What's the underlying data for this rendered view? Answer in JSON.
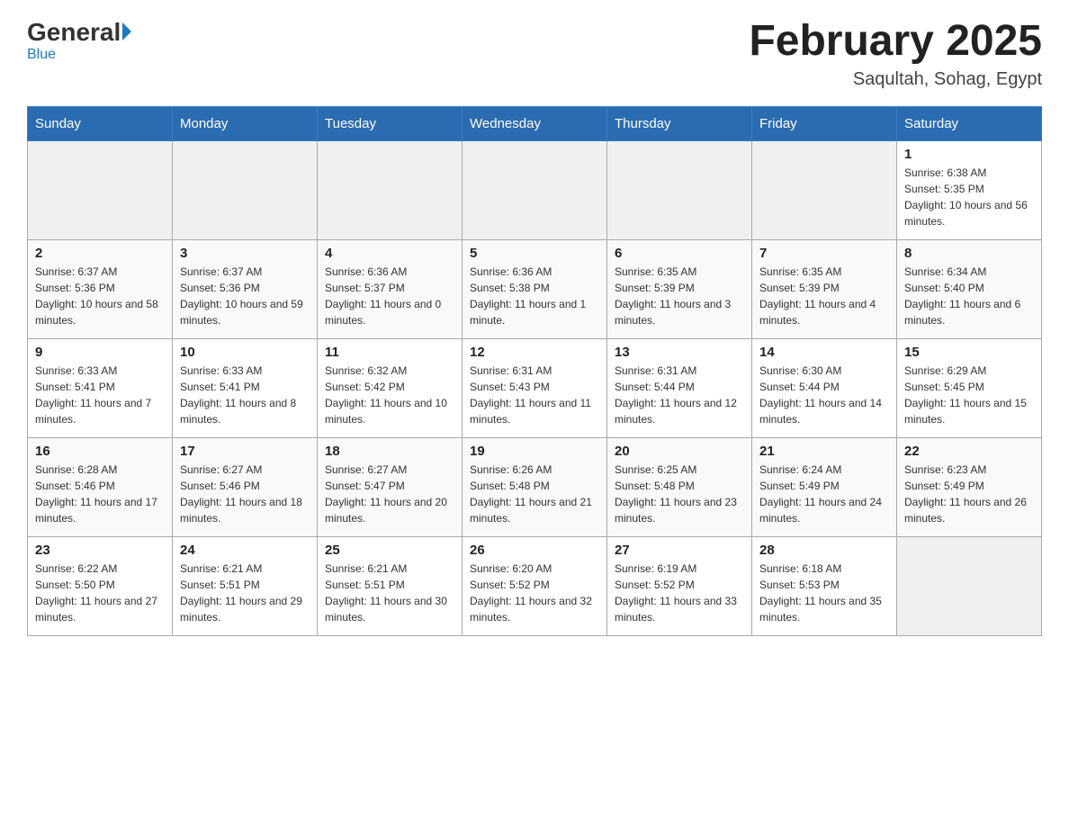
{
  "header": {
    "logo_general": "General",
    "logo_blue": "Blue",
    "month_title": "February 2025",
    "location": "Saqultah, Sohag, Egypt"
  },
  "days_of_week": [
    "Sunday",
    "Monday",
    "Tuesday",
    "Wednesday",
    "Thursday",
    "Friday",
    "Saturday"
  ],
  "weeks": [
    [
      {
        "day": "",
        "info": ""
      },
      {
        "day": "",
        "info": ""
      },
      {
        "day": "",
        "info": ""
      },
      {
        "day": "",
        "info": ""
      },
      {
        "day": "",
        "info": ""
      },
      {
        "day": "",
        "info": ""
      },
      {
        "day": "1",
        "info": "Sunrise: 6:38 AM\nSunset: 5:35 PM\nDaylight: 10 hours and 56 minutes."
      }
    ],
    [
      {
        "day": "2",
        "info": "Sunrise: 6:37 AM\nSunset: 5:36 PM\nDaylight: 10 hours and 58 minutes."
      },
      {
        "day": "3",
        "info": "Sunrise: 6:37 AM\nSunset: 5:36 PM\nDaylight: 10 hours and 59 minutes."
      },
      {
        "day": "4",
        "info": "Sunrise: 6:36 AM\nSunset: 5:37 PM\nDaylight: 11 hours and 0 minutes."
      },
      {
        "day": "5",
        "info": "Sunrise: 6:36 AM\nSunset: 5:38 PM\nDaylight: 11 hours and 1 minute."
      },
      {
        "day": "6",
        "info": "Sunrise: 6:35 AM\nSunset: 5:39 PM\nDaylight: 11 hours and 3 minutes."
      },
      {
        "day": "7",
        "info": "Sunrise: 6:35 AM\nSunset: 5:39 PM\nDaylight: 11 hours and 4 minutes."
      },
      {
        "day": "8",
        "info": "Sunrise: 6:34 AM\nSunset: 5:40 PM\nDaylight: 11 hours and 6 minutes."
      }
    ],
    [
      {
        "day": "9",
        "info": "Sunrise: 6:33 AM\nSunset: 5:41 PM\nDaylight: 11 hours and 7 minutes."
      },
      {
        "day": "10",
        "info": "Sunrise: 6:33 AM\nSunset: 5:41 PM\nDaylight: 11 hours and 8 minutes."
      },
      {
        "day": "11",
        "info": "Sunrise: 6:32 AM\nSunset: 5:42 PM\nDaylight: 11 hours and 10 minutes."
      },
      {
        "day": "12",
        "info": "Sunrise: 6:31 AM\nSunset: 5:43 PM\nDaylight: 11 hours and 11 minutes."
      },
      {
        "day": "13",
        "info": "Sunrise: 6:31 AM\nSunset: 5:44 PM\nDaylight: 11 hours and 12 minutes."
      },
      {
        "day": "14",
        "info": "Sunrise: 6:30 AM\nSunset: 5:44 PM\nDaylight: 11 hours and 14 minutes."
      },
      {
        "day": "15",
        "info": "Sunrise: 6:29 AM\nSunset: 5:45 PM\nDaylight: 11 hours and 15 minutes."
      }
    ],
    [
      {
        "day": "16",
        "info": "Sunrise: 6:28 AM\nSunset: 5:46 PM\nDaylight: 11 hours and 17 minutes."
      },
      {
        "day": "17",
        "info": "Sunrise: 6:27 AM\nSunset: 5:46 PM\nDaylight: 11 hours and 18 minutes."
      },
      {
        "day": "18",
        "info": "Sunrise: 6:27 AM\nSunset: 5:47 PM\nDaylight: 11 hours and 20 minutes."
      },
      {
        "day": "19",
        "info": "Sunrise: 6:26 AM\nSunset: 5:48 PM\nDaylight: 11 hours and 21 minutes."
      },
      {
        "day": "20",
        "info": "Sunrise: 6:25 AM\nSunset: 5:48 PM\nDaylight: 11 hours and 23 minutes."
      },
      {
        "day": "21",
        "info": "Sunrise: 6:24 AM\nSunset: 5:49 PM\nDaylight: 11 hours and 24 minutes."
      },
      {
        "day": "22",
        "info": "Sunrise: 6:23 AM\nSunset: 5:49 PM\nDaylight: 11 hours and 26 minutes."
      }
    ],
    [
      {
        "day": "23",
        "info": "Sunrise: 6:22 AM\nSunset: 5:50 PM\nDaylight: 11 hours and 27 minutes."
      },
      {
        "day": "24",
        "info": "Sunrise: 6:21 AM\nSunset: 5:51 PM\nDaylight: 11 hours and 29 minutes."
      },
      {
        "day": "25",
        "info": "Sunrise: 6:21 AM\nSunset: 5:51 PM\nDaylight: 11 hours and 30 minutes."
      },
      {
        "day": "26",
        "info": "Sunrise: 6:20 AM\nSunset: 5:52 PM\nDaylight: 11 hours and 32 minutes."
      },
      {
        "day": "27",
        "info": "Sunrise: 6:19 AM\nSunset: 5:52 PM\nDaylight: 11 hours and 33 minutes."
      },
      {
        "day": "28",
        "info": "Sunrise: 6:18 AM\nSunset: 5:53 PM\nDaylight: 11 hours and 35 minutes."
      },
      {
        "day": "",
        "info": ""
      }
    ]
  ]
}
